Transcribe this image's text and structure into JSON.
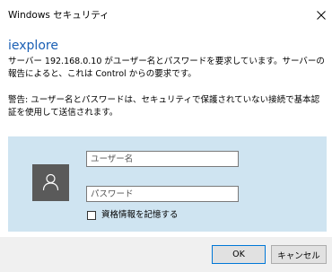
{
  "window": {
    "title": "Windows セキュリティ",
    "close_glyph": "×"
  },
  "app": {
    "name": "iexplore"
  },
  "messages": {
    "server_request": "サーバー 192.168.0.10 がユーザー名とパスワードを要求しています。サーバーの報告によると、これは Control からの要求です。",
    "warning": "警告: ユーザー名とパスワードは、セキュリティで保護されていない接続で基本認証を使用して送信されます。"
  },
  "form": {
    "username": {
      "placeholder": "ユーザー名",
      "value": ""
    },
    "password": {
      "placeholder": "パスワード",
      "value": ""
    },
    "remember_label": "資格情報を記憶する",
    "remember_checked": false
  },
  "buttons": {
    "ok_label": "OK",
    "cancel_label": "キャンセル"
  },
  "colors": {
    "accent": "#1a5fb4",
    "panel_background": "#cfe4f1",
    "avatar_background": "#5a5a5a",
    "footer_background": "#f0f0f0",
    "default_button_border": "#0078d7"
  },
  "icons": {
    "close": "close-icon",
    "avatar": "user-icon"
  }
}
